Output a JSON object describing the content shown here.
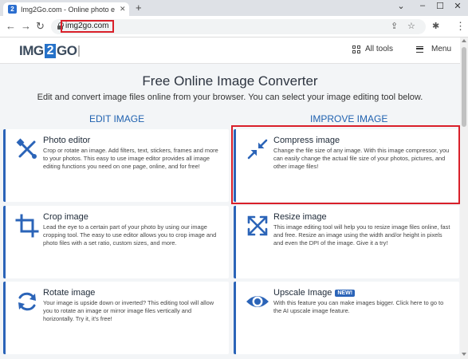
{
  "browser": {
    "tab_title": "Img2Go.com - Online photo edi",
    "tab_favicon": "2",
    "url": "img2go.com"
  },
  "header": {
    "logo_left": "IMG",
    "logo_mid": "2",
    "logo_right": "GO",
    "all_tools_label": "All tools",
    "menu_label": "Menu"
  },
  "main": {
    "title": "Free Online Image Converter",
    "intro": "Edit and convert image files online from your browser. You can select your image editing tool below.",
    "edit_heading": "EDIT IMAGE",
    "improve_heading": "IMPROVE IMAGE"
  },
  "cards": {
    "photo_editor": {
      "title": "Photo editor",
      "desc": "Crop or rotate an image. Add filters, text, stickers, frames and more to your photos. This easy to use image editor provides all image editing functions you need on one page, online, and for free!"
    },
    "compress_image": {
      "title": "Compress image",
      "desc": "Change the file size of any image. With this image compressor, you can easily change the actual file size of your photos, pictures, and other image files!"
    },
    "crop_image": {
      "title": "Crop image",
      "desc": "Lead the eye to a certain part of your photo by using our image cropping tool. The easy to use editor allows you to crop image and photo files with a set ratio, custom sizes, and more."
    },
    "resize_image": {
      "title": "Resize image",
      "desc": "This image editing tool will help you to resize image files online, fast and free. Resize an image using the width and/or height in pixels and even the DPI of the image. Give it a try!"
    },
    "rotate_image": {
      "title": "Rotate image",
      "desc": "Your image is upside down or inverted? This editing tool will allow you to rotate an image or mirror image files vertically and horizontally. Try it, it's free!"
    },
    "upscale_image": {
      "title": "Upscale Image",
      "badge": "NEW!",
      "desc": "With this feature you can make images bigger. Click here to go to the AI upscale image feature."
    }
  },
  "colors": {
    "accent": "#2b64b8",
    "highlight_border": "#d9202a"
  },
  "icons": [
    "crossed-tools-icon",
    "compress-arrows-icon",
    "crop-icon",
    "expand-arrows-icon",
    "rotate-icon",
    "eye-icon"
  ]
}
